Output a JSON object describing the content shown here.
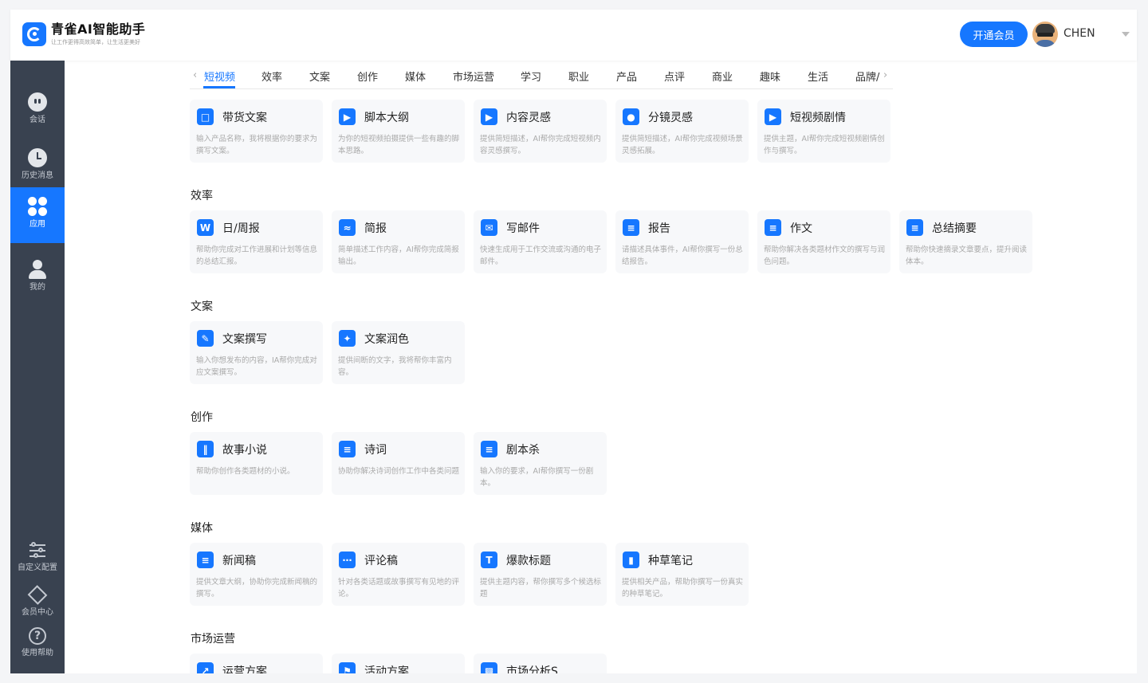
{
  "app": {
    "title": "青雀AI智能助手",
    "slogan": "让工作更得高效简单，让生活更美好"
  },
  "header": {
    "vip_label": "开通会员",
    "user_name": "CHEN"
  },
  "sidebar": {
    "items": [
      {
        "label": "会话",
        "icon": "chat-icon"
      },
      {
        "label": "历史消息",
        "icon": "clock-icon"
      },
      {
        "label": "应用",
        "icon": "apps-icon",
        "active": true
      },
      {
        "label": "我的",
        "icon": "user-icon"
      }
    ],
    "bottom_items": [
      {
        "label": "自定义配置",
        "icon": "sliders-icon"
      },
      {
        "label": "会员中心",
        "icon": "diamond-icon"
      },
      {
        "label": "使用帮助",
        "icon": "help-icon"
      }
    ]
  },
  "tabs": [
    "短视频",
    "效率",
    "文案",
    "创作",
    "媒体",
    "市场运营",
    "学习",
    "职业",
    "产品",
    "点评",
    "商业",
    "趣味",
    "生活",
    "品牌/"
  ],
  "sections": [
    {
      "title": "",
      "cards": [
        {
          "title": "带货文案",
          "icon": "video-card-icon",
          "desc": "输入产品名称，我将根据你的要求为撰写文案。"
        },
        {
          "title": "脚本大纲",
          "icon": "play-icon",
          "desc": "为你的短视频拍摄提供一些有趣的脚本思路。"
        },
        {
          "title": "内容灵感",
          "icon": "film-icon",
          "desc": "提供简短描述，AI帮你完成短视频内容灵感撰写。"
        },
        {
          "title": "分镜灵感",
          "icon": "camera-icon",
          "desc": "提供简短描述，AI帮你完成视频场景灵感拓展。"
        },
        {
          "title": "短视频剧情",
          "icon": "film-strip-icon",
          "desc": "提供主题，AI帮你完成短视频剧情创作与撰写。"
        }
      ]
    },
    {
      "title": "效率",
      "cards": [
        {
          "title": "日/周报",
          "icon": "calendar-icon",
          "desc": "帮助你完成对工作进展和计划等信息的总结汇报。"
        },
        {
          "title": "简报",
          "icon": "chart-doc-icon",
          "desc": "简单描述工作内容，AI帮你完成简报输出。"
        },
        {
          "title": "写邮件",
          "icon": "mail-icon",
          "desc": "快速生成用于工作交流或沟通的电子邮件。"
        },
        {
          "title": "报告",
          "icon": "report-icon",
          "desc": "请描述具体事件，AI帮你撰写一份总结报告。"
        },
        {
          "title": "作文",
          "icon": "document-icon",
          "desc": "帮助你解决各类题材作文的撰写与润色问题。"
        },
        {
          "title": "总结摘要",
          "icon": "summary-icon",
          "desc": "帮助你快速摘录文章要点，提升阅读体本。"
        }
      ]
    },
    {
      "title": "文案",
      "cards": [
        {
          "title": "文案撰写",
          "icon": "pen-icon",
          "desc": "输入你想发布的内容，IA帮你完成对应文案撰写。"
        },
        {
          "title": "文案润色",
          "icon": "magic-wand-icon",
          "desc": "提供间断的文字，我将帮你丰富内容。"
        }
      ]
    },
    {
      "title": "创作",
      "cards": [
        {
          "title": "故事小说",
          "icon": "books-icon",
          "desc": "帮助你创作各类题材的小说。"
        },
        {
          "title": "诗词",
          "icon": "poem-icon",
          "desc": "协助你解决诗词创作工作中各类问题"
        },
        {
          "title": "剧本杀",
          "icon": "open-book-icon",
          "desc": "输入你的要求，AI帮你撰写一份剧本。"
        }
      ]
    },
    {
      "title": "媒体",
      "cards": [
        {
          "title": "新闻稿",
          "icon": "news-icon",
          "desc": "提供文章大纲，协助你完成新闻稿的撰写。"
        },
        {
          "title": "评论稿",
          "icon": "comment-icon",
          "desc": "针对各类话题或故事撰写有见地的评论。"
        },
        {
          "title": "爆款标题",
          "icon": "title-icon",
          "desc": "提供主题内容，帮你撰写多个候选标题"
        },
        {
          "title": "种草笔记",
          "icon": "notebook-icon",
          "desc": "提供相关产品，帮助你撰写一份真实的种草笔记。"
        }
      ]
    },
    {
      "title": "市场运营",
      "cards": [
        {
          "title": "运营方案",
          "icon": "trend-icon",
          "desc": ""
        },
        {
          "title": "活动方案",
          "icon": "flag-icon",
          "desc": ""
        },
        {
          "title": "市场分析S",
          "icon": "bar-chart-icon",
          "desc": ""
        }
      ]
    }
  ],
  "colors": {
    "accent": "#1677ff",
    "sidebar_bg": "#394250",
    "card_bg": "#f7f8fa"
  }
}
